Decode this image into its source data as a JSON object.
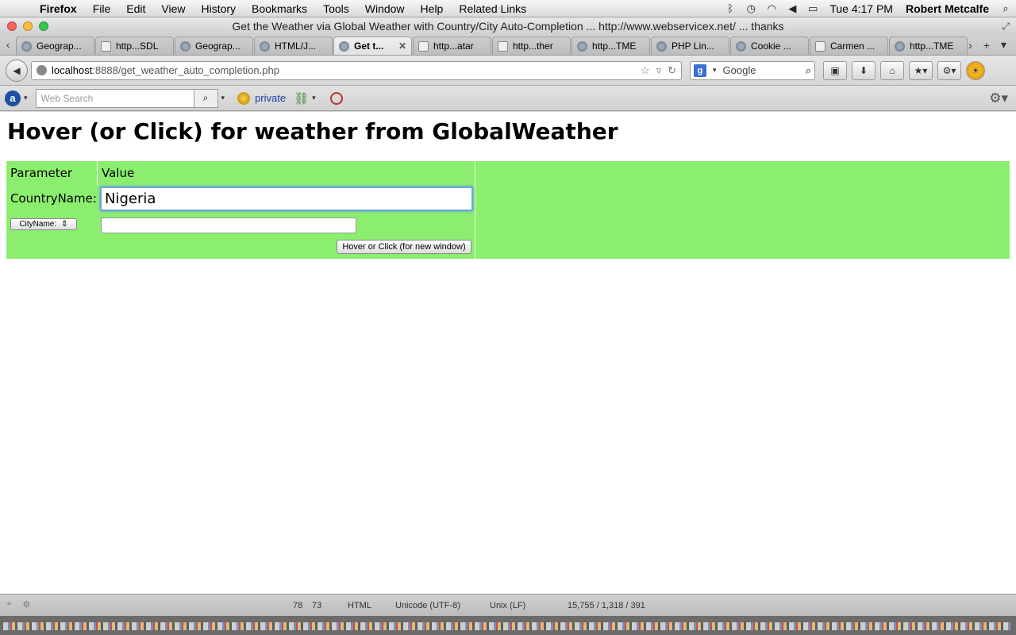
{
  "menubar": {
    "app": "Firefox",
    "items": [
      "File",
      "Edit",
      "View",
      "History",
      "Bookmarks",
      "Tools",
      "Window",
      "Help",
      "Related Links"
    ],
    "clock": "Tue 4:17 PM",
    "user": "Robert Metcalfe"
  },
  "window": {
    "title": "Get the Weather via Global Weather with Country/City Auto-Completion ... http://www.webservicex.net/ ... thanks"
  },
  "tabs": [
    {
      "label": "Geograp..."
    },
    {
      "label": "http...SDL"
    },
    {
      "label": "Geograp..."
    },
    {
      "label": "HTML/J..."
    },
    {
      "label": "Get t..."
    },
    {
      "label": "http...atar"
    },
    {
      "label": "http...ther"
    },
    {
      "label": "http...TME"
    },
    {
      "label": "PHP Lin..."
    },
    {
      "label": "Cookie ..."
    },
    {
      "label": "Carmen ..."
    },
    {
      "label": "http...TME"
    }
  ],
  "navbar": {
    "url_host": "localhost",
    "url_rest": ":8888/get_weather_auto_completion.php",
    "search_engine": "Google"
  },
  "toolbar2": {
    "websearch_placeholder": "Web Search",
    "private_label": "private"
  },
  "page": {
    "title": "Hover (or Click) for weather from GlobalWeather",
    "table": {
      "header_param": "Parameter",
      "header_value": "Value",
      "country_label": "CountryName:",
      "country_value": "Nigeria",
      "city_select_label": "CityName:",
      "city_value": "",
      "hover_button": "Hover or Click (for new window)"
    },
    "table_color": "#8cee6f"
  },
  "statusbar": {
    "line": "78",
    "col": "73",
    "language": "HTML",
    "encoding": "Unicode (UTF-8)",
    "line_endings": "Unix (LF)",
    "stats": "15,755 / 1,318 / 391"
  }
}
